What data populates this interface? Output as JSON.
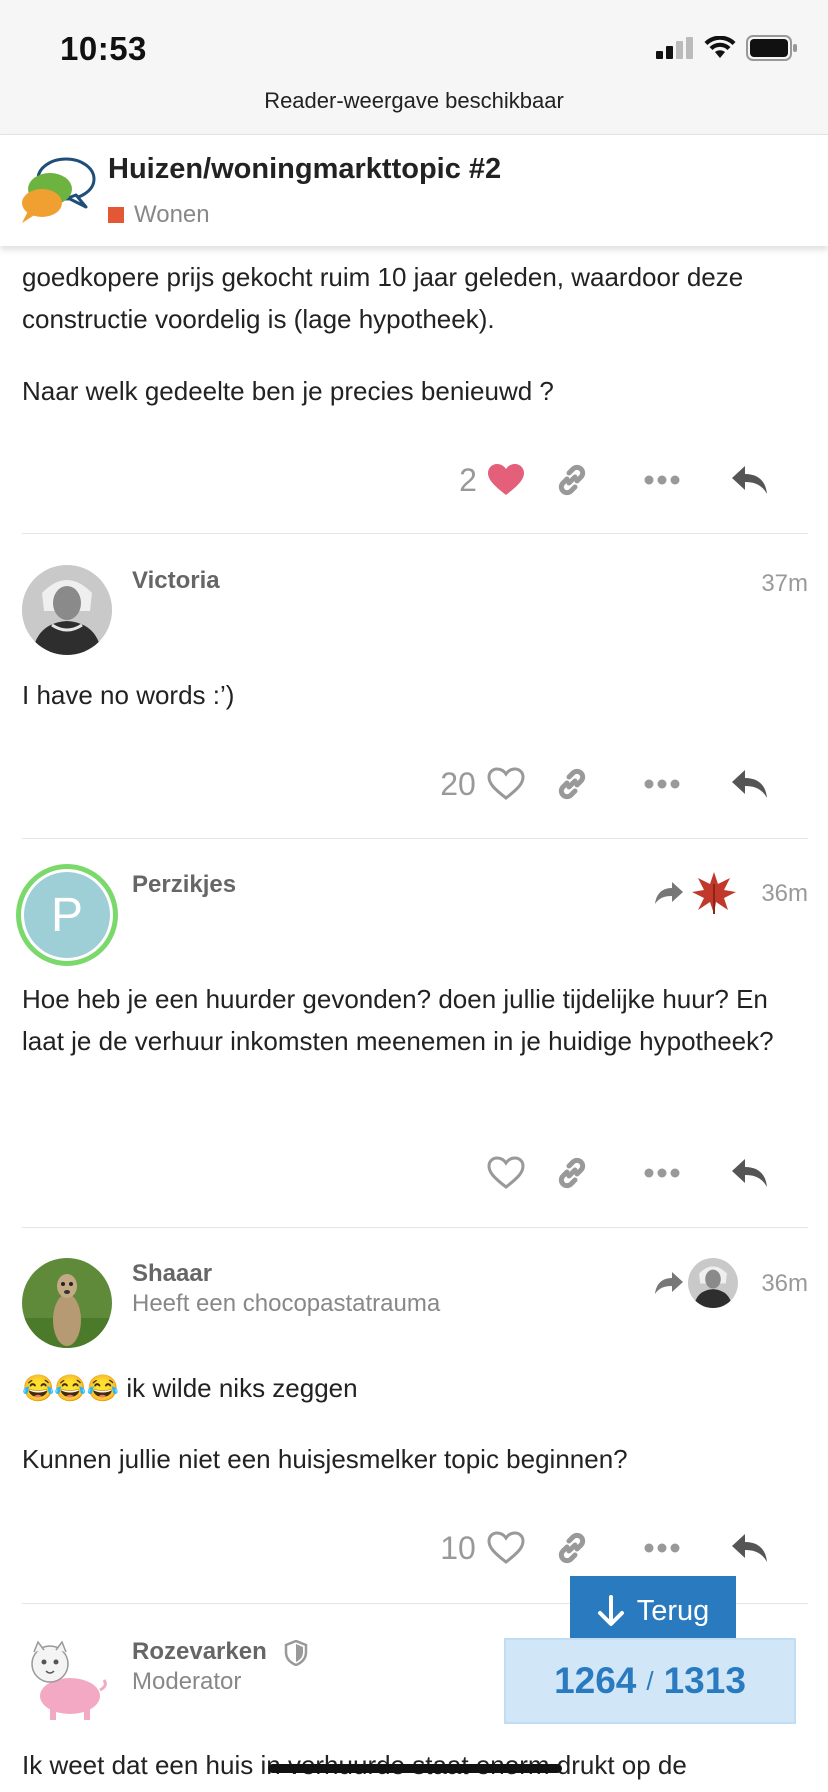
{
  "status_bar": {
    "time": "10:53"
  },
  "reader_bar": {
    "label": "Reader-weergave beschikbaar"
  },
  "topic": {
    "title": "Huizen/woningmarkttopic #2",
    "category": "Wonen",
    "category_color": "#e45735"
  },
  "posts": [
    {
      "paragraphs": [
        "goedkopere prijs gekocht ruim 10 jaar geleden, waardoor deze constructie voordelig is (lage hypotheek).",
        "Naar welk gedeelte ben je precies benieuwd ?"
      ],
      "likes": "2",
      "liked": true
    },
    {
      "username": "Victoria",
      "time": "37m",
      "paragraphs": [
        "I have no words :’)"
      ],
      "likes": "20"
    },
    {
      "username": "Perzikjes",
      "avatar_letter": "P",
      "time": "36m",
      "paragraphs": [
        "Hoe heb je een huurder gevonden? doen jullie tijdelijke huur? En laat je de verhuur inkomsten meenemen in je huidige hypotheek?"
      ],
      "likes": ""
    },
    {
      "username": "Shaaar",
      "user_title": "Heeft een chocopastatrauma",
      "time": "36m",
      "emoji_text": "😂😂😂",
      "paragraphs": [
        "ik wilde niks zeggen",
        "Kunnen jullie niet een huisjesmelker topic beginnen?"
      ],
      "likes": "10"
    },
    {
      "username": "Rozevarken",
      "user_title": "Moderator",
      "paragraphs": [
        "Ik weet dat een huis in verhuurde staat enorm drukt op de"
      ]
    }
  ],
  "jump_button": {
    "label": "Terug"
  },
  "progress": {
    "current": "1264",
    "separator": "/",
    "total": "1313"
  },
  "colors": {
    "heart_liked": "#e45f7a",
    "accent": "#2a7ac0"
  }
}
